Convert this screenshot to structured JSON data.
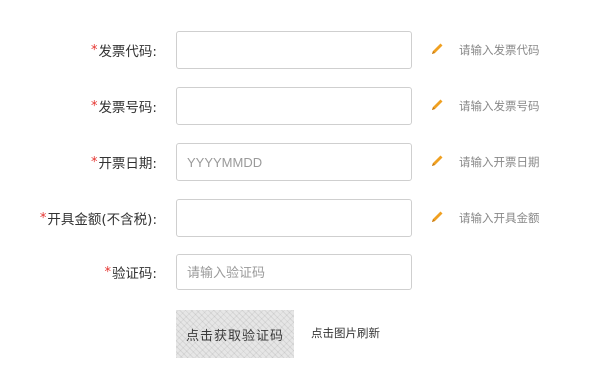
{
  "form": {
    "required_mark": "*",
    "invoice_code": {
      "label": "发票代码:",
      "value": "",
      "placeholder": "",
      "hint": "请输入发票代码"
    },
    "invoice_number": {
      "label": "发票号码:",
      "value": "",
      "placeholder": "",
      "hint": "请输入发票号码"
    },
    "issue_date": {
      "label": "开票日期:",
      "value": "",
      "placeholder": "YYYYMMDD",
      "hint": "请输入开票日期"
    },
    "amount_ex_tax": {
      "label": "开具金额(不含税):",
      "value": "",
      "placeholder": "",
      "hint": "请输入开具金额"
    },
    "captcha": {
      "label": "验证码:",
      "value": "",
      "placeholder": "请输入验证码"
    },
    "captcha_image_text": "点击获取验证码",
    "captcha_refresh_tip": "点击图片刷新"
  },
  "colors": {
    "required": "#e5322e",
    "pencil": "#f0a020",
    "input_border": "#cfcfcf",
    "hint_text": "#888888"
  },
  "icons": {
    "edit": "pencil-icon"
  }
}
